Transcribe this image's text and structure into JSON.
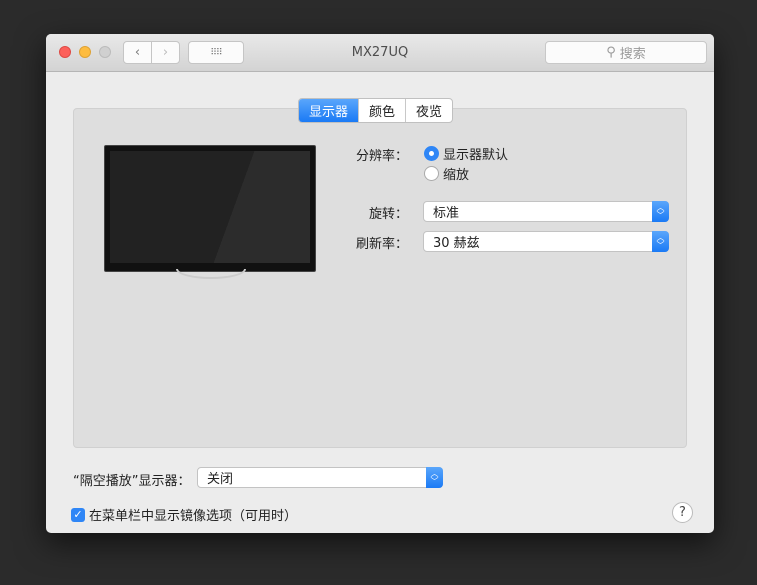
{
  "window": {
    "title": "MX27UQ",
    "search_placeholder": "搜索"
  },
  "tabs": [
    {
      "label": "显示器",
      "active": true
    },
    {
      "label": "颜色"
    },
    {
      "label": "夜览"
    }
  ],
  "resolution": {
    "label": "分辨率：",
    "options": [
      {
        "label": "显示器默认",
        "selected": true
      },
      {
        "label": "缩放",
        "selected": false
      }
    ]
  },
  "rotation": {
    "label": "旋转：",
    "value": "标准"
  },
  "refresh": {
    "label": "刷新率：",
    "value": "30 赫兹"
  },
  "airplay": {
    "label": "“隔空播放”显示器：",
    "value": "关闭"
  },
  "mirror_checkbox": {
    "label": "在菜单栏中显示镜像选项（可用时）",
    "checked": true
  },
  "help": "?",
  "colors": {
    "accent": "#1a7af5"
  }
}
